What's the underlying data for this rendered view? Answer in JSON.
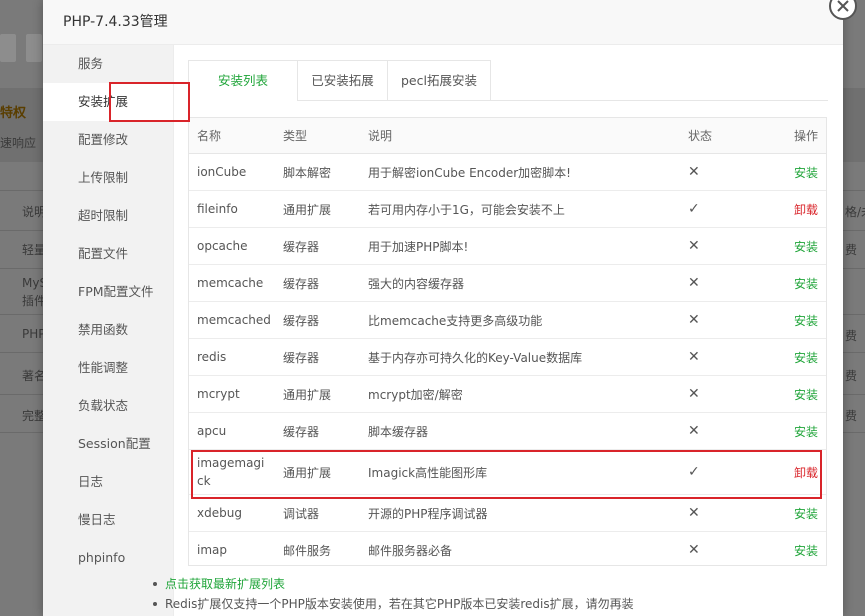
{
  "colors": {
    "accent": "#20a53a",
    "danger": "#d9242a"
  },
  "background": {
    "title": "特权",
    "subtitle": "速响应",
    "col_label": "说明",
    "rows": [
      "轻量",
      "MyS",
      "插件",
      "PHP",
      "著名",
      "完整"
    ],
    "right_col": [
      "格/未",
      "费",
      "费",
      "费",
      "费"
    ]
  },
  "modal": {
    "title": "PHP-7.4.33管理",
    "close_icon": "close-icon"
  },
  "sidebar": {
    "active_index": 1,
    "items": [
      {
        "label": "服务"
      },
      {
        "label": "安装扩展"
      },
      {
        "label": "配置修改"
      },
      {
        "label": "上传限制"
      },
      {
        "label": "超时限制"
      },
      {
        "label": "配置文件"
      },
      {
        "label": "FPM配置文件"
      },
      {
        "label": "禁用函数"
      },
      {
        "label": "性能调整"
      },
      {
        "label": "负载状态"
      },
      {
        "label": "Session配置"
      },
      {
        "label": "日志"
      },
      {
        "label": "慢日志"
      },
      {
        "label": "phpinfo"
      }
    ]
  },
  "tabs": [
    {
      "label": "安装列表"
    },
    {
      "label": "已安装拓展"
    },
    {
      "label": "pecl拓展安装"
    }
  ],
  "table": {
    "headers": [
      "名称",
      "类型",
      "说明",
      "状态",
      "操作"
    ],
    "rows": [
      {
        "name": "ionCube",
        "type": "脚本解密",
        "desc": "用于解密ionCube Encoder加密脚本!",
        "status": "✕",
        "installed": false,
        "action": "安装"
      },
      {
        "name": "fileinfo",
        "type": "通用扩展",
        "desc": "若可用内存小于1G，可能会安装不上",
        "status": "✓",
        "installed": true,
        "action": "卸载"
      },
      {
        "name": "opcache",
        "type": "缓存器",
        "desc": "用于加速PHP脚本!",
        "status": "✕",
        "installed": false,
        "action": "安装"
      },
      {
        "name": "memcache",
        "type": "缓存器",
        "desc": "强大的内容缓存器",
        "status": "✕",
        "installed": false,
        "action": "安装"
      },
      {
        "name": "memcached",
        "type": "缓存器",
        "desc": "比memcache支持更多高级功能",
        "status": "✕",
        "installed": false,
        "action": "安装"
      },
      {
        "name": "redis",
        "type": "缓存器",
        "desc": "基于内存亦可持久化的Key-Value数据库",
        "status": "✕",
        "installed": false,
        "action": "安装"
      },
      {
        "name": "mcrypt",
        "type": "通用扩展",
        "desc": "mcrypt加密/解密",
        "status": "✕",
        "installed": false,
        "action": "安装"
      },
      {
        "name": "apcu",
        "type": "缓存器",
        "desc": "脚本缓存器",
        "status": "✕",
        "installed": false,
        "action": "安装"
      },
      {
        "name": "imagemagick",
        "type": "通用扩展",
        "desc": "Imagick高性能图形库",
        "status": "✓",
        "installed": true,
        "action": "卸载"
      },
      {
        "name": "xdebug",
        "type": "调试器",
        "desc": "开源的PHP程序调试器",
        "status": "✕",
        "installed": false,
        "action": "安装"
      },
      {
        "name": "imap",
        "type": "邮件服务",
        "desc": "邮件服务器必备",
        "status": "✕",
        "installed": false,
        "action": "安装"
      }
    ]
  },
  "notes": {
    "refresh_link": "点击获取最新扩展列表",
    "redis_note": "Redis扩展仅支持一个PHP版本安装使用，若在其它PHP版本已安装redis扩展，请勿再装"
  }
}
